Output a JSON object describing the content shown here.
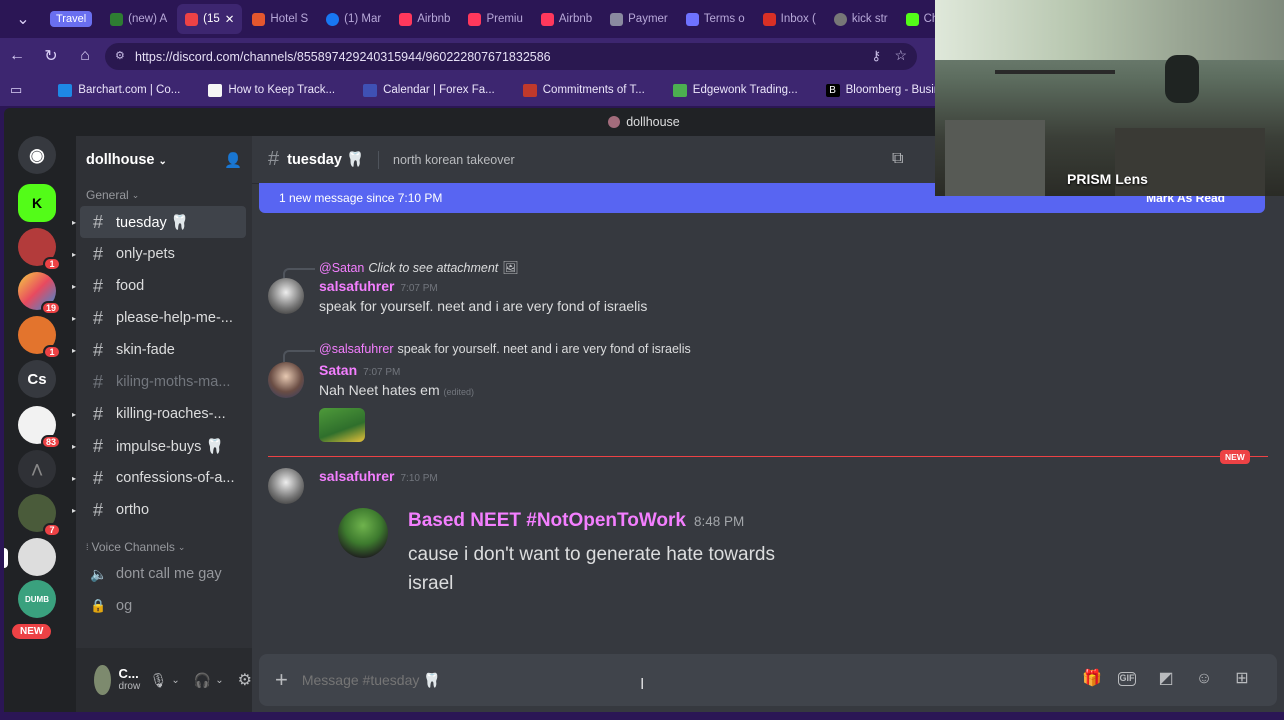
{
  "browser": {
    "tab_group": "Travel",
    "tabs": [
      {
        "label": "(new) A",
        "color": "#2e7d32"
      },
      {
        "label": "(15",
        "color": "#ed4245",
        "active": true
      },
      {
        "label": "Hotel S",
        "color": "#e4572e"
      },
      {
        "label": "(1) Mar",
        "color": "#1877f2"
      },
      {
        "label": "Airbnb",
        "color": "#ff385c"
      },
      {
        "label": "Premiu",
        "color": "#ff385c"
      },
      {
        "label": "Airbnb",
        "color": "#ff385c"
      },
      {
        "label": "Paymer",
        "color": "#8a8aa0"
      },
      {
        "label": "Terms o",
        "color": "#6f72ff"
      },
      {
        "label": "Inbox (",
        "color": "#d93025"
      },
      {
        "label": "kick str",
        "color": "#777"
      },
      {
        "label": "Chillur",
        "color": "#53fc18"
      }
    ],
    "url": "https://discord.com/channels/855897429240315944/960222807671832586",
    "bookmarks": [
      {
        "label": "Barchart.com | Co...",
        "color": "#1e88e5"
      },
      {
        "label": "How to Keep Track...",
        "color": "#f5f5f5"
      },
      {
        "label": "Calendar | Forex Fa...",
        "color": "#3f51b5"
      },
      {
        "label": "Commitments of T...",
        "color": "#c0392b"
      },
      {
        "label": "Edgewonk Trading...",
        "color": "#4caf50"
      },
      {
        "label": "Bloomberg - Busin...",
        "color": "#000000"
      }
    ]
  },
  "webcam": {
    "label": "PRISM Lens"
  },
  "discord": {
    "top_title": "dollhouse",
    "guild_badges": [
      "1",
      "19",
      "1",
      "83",
      "7"
    ],
    "guild_text": "Cs",
    "new_label": "NEW",
    "server_name": "dollhouse",
    "category_general": "General",
    "channels": [
      {
        "name": "tuesday 🦷",
        "selected": true
      },
      {
        "name": "only-pets"
      },
      {
        "name": "food"
      },
      {
        "name": "please-help-me-..."
      },
      {
        "name": "skin-fade"
      },
      {
        "name": "kiling-moths-ma...",
        "muted": true
      },
      {
        "name": "killing-roaches-..."
      },
      {
        "name": "impulse-buys 🦷"
      },
      {
        "name": "confessions-of-a..."
      },
      {
        "name": "ortho"
      }
    ],
    "category_voice": "Voice Channels",
    "voice_channels": [
      "dont call me gay",
      "og"
    ],
    "user": {
      "name": "C...",
      "status": "drow"
    },
    "channel_header": {
      "name": "tuesday 🦷",
      "topic": "north korean takeover"
    },
    "new_messages_bar": {
      "text": "1 new message since 7:10 PM",
      "action": "Mark As Read"
    },
    "messages": [
      {
        "reply_to": "@Satan",
        "reply_text": "Click to see attachment",
        "author": "salsafuhrer",
        "time": "7:07 PM",
        "text": "speak for yourself. neet and i are very fond of israelis",
        "color": "#f47fff"
      },
      {
        "reply_to": "@salsafuhrer",
        "reply_text": "speak for yourself. neet and i are very fond of israelis",
        "author": "Satan",
        "time": "7:07 PM",
        "text": "Nah Neet hates em",
        "edited": "(edited)",
        "color": "#f47fff"
      },
      {
        "author": "salsafuhrer",
        "time": "7:10 PM",
        "color": "#f47fff",
        "embed": {
          "author": "Based NEET #NotOpenToWork",
          "time": "8:48 PM",
          "text_line1": "cause i don't want to generate hate towards",
          "text_line2": "israel"
        }
      }
    ],
    "new_divider": "NEW",
    "composer_placeholder": "Message #tuesday 🦷"
  }
}
